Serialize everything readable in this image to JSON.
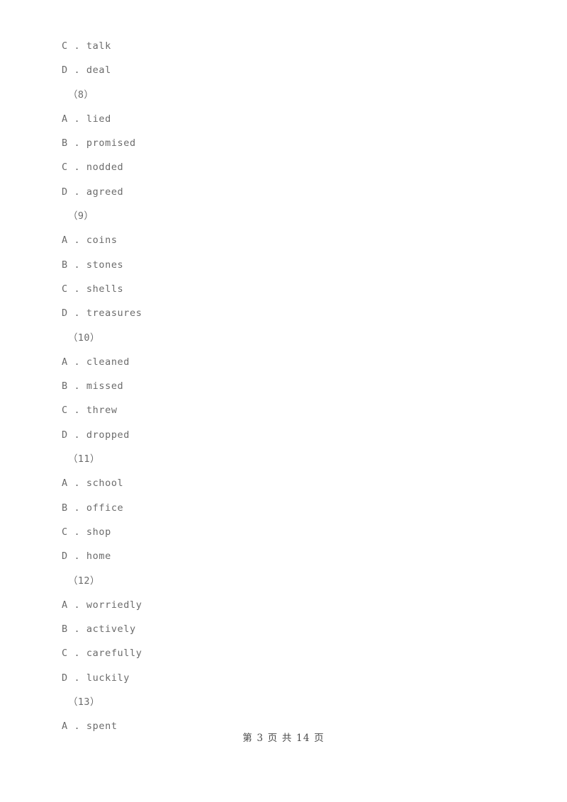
{
  "document": {
    "page_background": "#ffffff",
    "body_text_color": "#6b6b6b",
    "footer_text_color": "#4a4a4a"
  },
  "body": {
    "lines": [
      {
        "type": "option",
        "text": "C . talk"
      },
      {
        "type": "option",
        "text": "D . deal"
      },
      {
        "type": "question",
        "text": "（8）"
      },
      {
        "type": "option",
        "text": "A . lied"
      },
      {
        "type": "option",
        "text": "B . promised"
      },
      {
        "type": "option",
        "text": "C . nodded"
      },
      {
        "type": "option",
        "text": "D . agreed"
      },
      {
        "type": "question",
        "text": "（9）"
      },
      {
        "type": "option",
        "text": "A . coins"
      },
      {
        "type": "option",
        "text": "B . stones"
      },
      {
        "type": "option",
        "text": "C . shells"
      },
      {
        "type": "option",
        "text": "D . treasures"
      },
      {
        "type": "question",
        "text": "（10）"
      },
      {
        "type": "option",
        "text": "A . cleaned"
      },
      {
        "type": "option",
        "text": "B . missed"
      },
      {
        "type": "option",
        "text": "C . threw"
      },
      {
        "type": "option",
        "text": "D . dropped"
      },
      {
        "type": "question",
        "text": "（11）"
      },
      {
        "type": "option",
        "text": "A . school"
      },
      {
        "type": "option",
        "text": "B . office"
      },
      {
        "type": "option",
        "text": "C . shop"
      },
      {
        "type": "option",
        "text": "D . home"
      },
      {
        "type": "question",
        "text": "（12）"
      },
      {
        "type": "option",
        "text": "A . worriedly"
      },
      {
        "type": "option",
        "text": "B . actively"
      },
      {
        "type": "option",
        "text": "C . carefully"
      },
      {
        "type": "option",
        "text": "D . luckily"
      },
      {
        "type": "question",
        "text": "（13）"
      },
      {
        "type": "option",
        "text": "A . spent"
      }
    ]
  },
  "footer": {
    "text": "第 3 页 共 14 页",
    "current_page": "3",
    "total_pages": "14"
  }
}
